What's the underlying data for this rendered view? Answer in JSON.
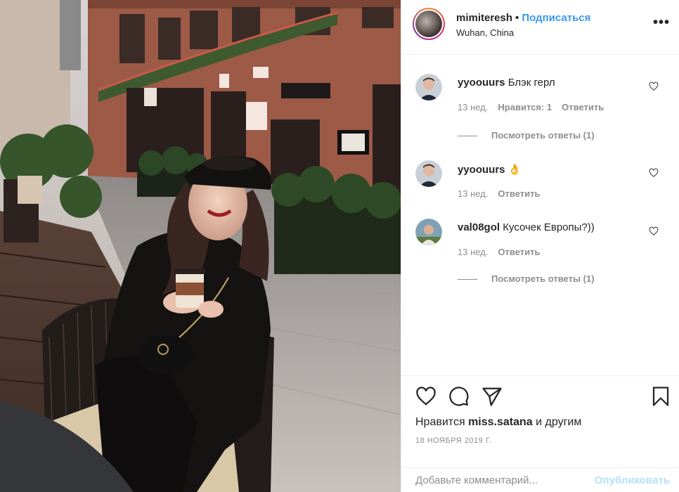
{
  "post": {
    "owner": "mimiteresh",
    "separator": "•",
    "follow_label": "Подписаться",
    "location": "Wuhan, China",
    "more_icon": "more-dots-icon"
  },
  "comments": [
    {
      "user": "yyoouurs",
      "text": "Блэк герл",
      "time": "13 нед.",
      "likes": "Нравится: 1",
      "reply_label": "Ответить",
      "view_replies": "Посмотреть ответы (1)"
    },
    {
      "user": "yyoouurs",
      "text": "👌",
      "time": "13 нед.",
      "reply_label": "Ответить"
    },
    {
      "user": "val08gol",
      "text": "Кусочек Европы?))",
      "time": "13 нед.",
      "reply_label": "Ответить",
      "view_replies": "Посмотреть ответы (1)"
    }
  ],
  "actions": {
    "liked_prefix": "Нравится",
    "liked_user": "miss.satana",
    "liked_suffix": "и другим",
    "date": "18 НОЯБРЯ 2019 Г.",
    "comment_placeholder": "Добавьте комментарий...",
    "publish_label": "Опубликовать"
  },
  "colors": {
    "accent": "#3897f0",
    "publish_disabled": "#b2dffc",
    "muted": "#8e8e8e"
  }
}
